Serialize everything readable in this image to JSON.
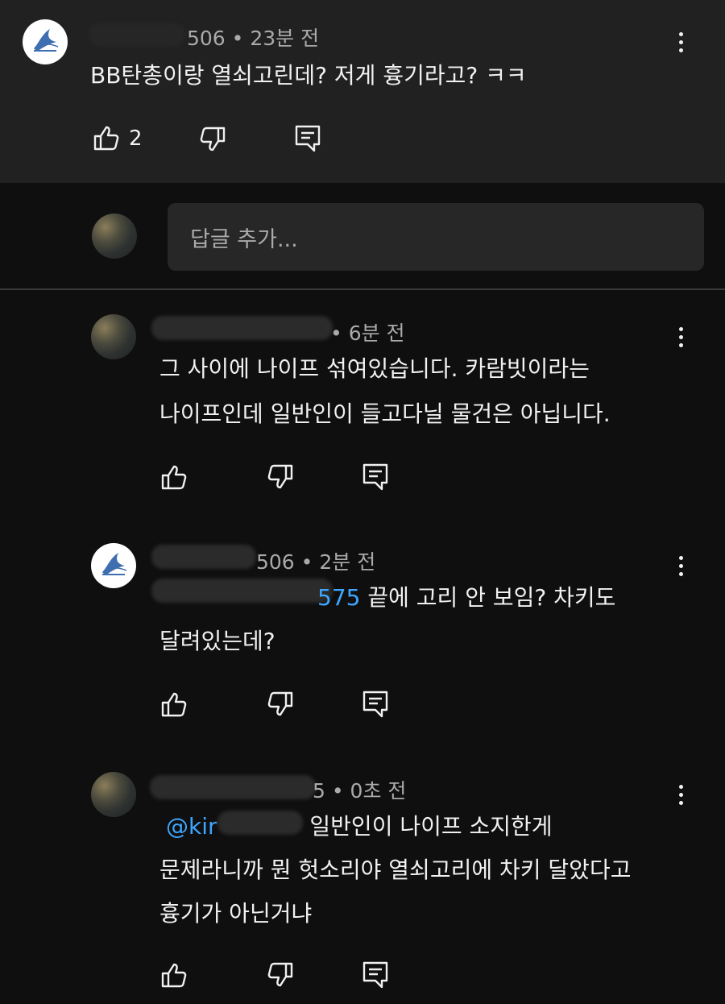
{
  "parent_comment": {
    "meta_visible": "506 • 23분 전",
    "text": "BB탄총이랑 열쇠고린데? 저게 흉기라고? ㅋㅋ",
    "like_count": "2",
    "avatar_icon": "blue-steel-logo-icon"
  },
  "reply_input": {
    "placeholder": "답글 추가..."
  },
  "replies": [
    {
      "meta_visible": "• 6분 전",
      "line1": "그 사이에 나이프 섞여있습니다. 카람빗이라는",
      "line2": "나이프인데 일반인이 들고다닐 물건은 아닙니다."
    },
    {
      "meta_visible": "506 • 2분 전",
      "mention_visible": "575",
      "line1_rest": " 끝에 고리 안 보임? 차키도",
      "line2": "달려있는데?"
    },
    {
      "meta_visible": "5 • 0초 전",
      "mention_visible": "@kir",
      "line1_rest": " 일반인이 나이프 소지한게",
      "line2": "문제라니까 뭔 헛소리야 열쇠고리에 차키 달았다고",
      "line3": "흉기가 아닌거냐"
    }
  ],
  "colors": {
    "background": "#0f0f0f",
    "parent_background": "#212121",
    "mention": "#3ea6ff",
    "meta": "#aaaaaa"
  }
}
